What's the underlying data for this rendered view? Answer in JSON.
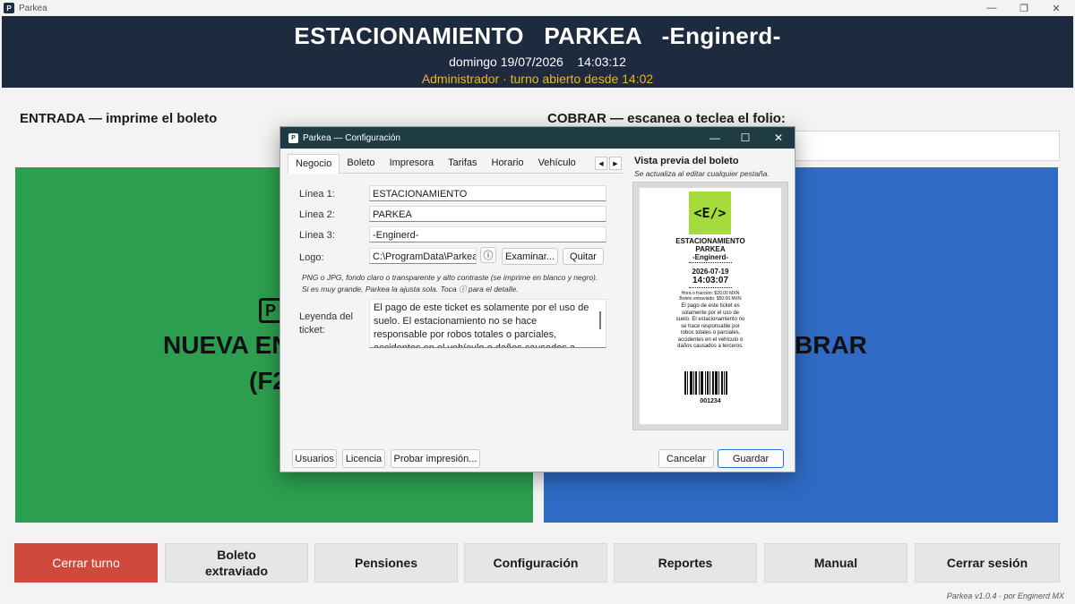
{
  "window": {
    "title": "Parkea"
  },
  "header": {
    "title": "ESTACIONAMIENTO   PARKEA   -Enginerd-",
    "datetime": "domingo 19/07/2026    14:03:12",
    "user_status": "Administrador  ·  turno abierto desde 14:02"
  },
  "sections": {
    "entrada": "ENTRADA — imprime el boleto",
    "cobrar": "COBRAR — escanea o teclea el folio:"
  },
  "panels": {
    "green_line1": "NUEVA EN",
    "green_line2": "(F2",
    "green_icon": "P",
    "blue_partial": "BRAR"
  },
  "bottom_buttons": [
    "Cerrar turno",
    "Boleto extraviado",
    "Pensiones",
    "Configuración",
    "Reportes",
    "Manual",
    "Cerrar sesión"
  ],
  "footer": "Parkea v1.0.4 · por Enginerd MX",
  "dialog": {
    "title": "Parkea — Configuración",
    "tabs": [
      "Negocio",
      "Boleto",
      "Impresora",
      "Tarifas",
      "Horario",
      "Vehículo"
    ],
    "active_tab": "Negocio",
    "fields": {
      "linea1_label": "Línea 1:",
      "linea1_value": "ESTACIONAMIENTO",
      "linea2_label": "Línea 2:",
      "linea2_value": "PARKEA",
      "linea3_label": "Línea 3:",
      "linea3_value": "-Enginerd-",
      "logo_label": "Logo:",
      "logo_value": "C:\\ProgramData\\Parkea\\",
      "examinar": "Examinar...",
      "quitar": "Quitar",
      "hint": "PNG o JPG, fondo claro o transparente y alto contraste (se imprime en blanco y negro). Si es muy grande, Parkea la ajusta sola. Toca ⓘ para el detalle.",
      "leyenda_label": "Leyenda del ticket:",
      "leyenda_value": "El pago de este ticket es solamente por el uso de suelo. El estacionamiento no se hace responsable por robos totales o parciales, accidentes en el vehículo o daños causados a terceros."
    },
    "buttons": {
      "usuarios": "Usuarios",
      "licencia": "Licencia",
      "probar": "Probar impresión...",
      "cancelar": "Cancelar",
      "guardar": "Guardar"
    },
    "preview": {
      "title": "Vista previa del boleto",
      "subtitle": "Se actualiza al editar cualquier pestaña.",
      "logo_text": "<E/>",
      "line1": "ESTACIONAMIENTO",
      "line2": "PARKEA",
      "line3": "-Enginerd-",
      "date": "2026-07-19",
      "time": "14:03:07",
      "rate1": "Hora o fracción: $20.00 MXN",
      "rate2": "Boleto extraviado: $50.00 MXN",
      "legend": "El pago de este ticket es solamente por el uso de suelo. El estacionamiento no se hace responsable por robos totales o parciales, accidentes en el vehículo o daños causados a terceros.",
      "folio": "001234"
    }
  }
}
